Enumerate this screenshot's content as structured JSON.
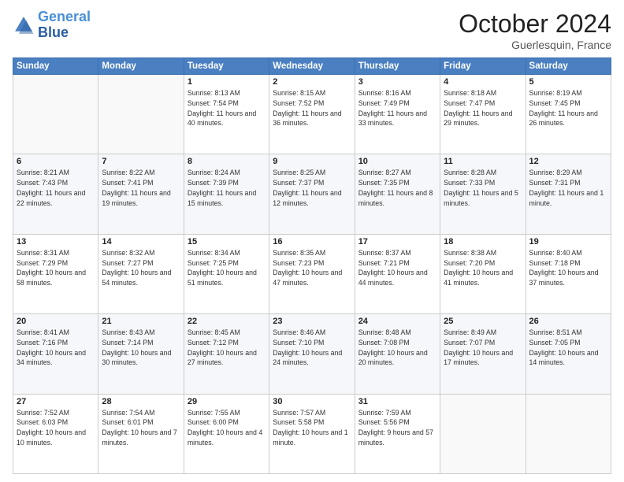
{
  "header": {
    "logo_line1": "General",
    "logo_line2": "Blue",
    "month": "October 2024",
    "location": "Guerlesquin, France"
  },
  "weekdays": [
    "Sunday",
    "Monday",
    "Tuesday",
    "Wednesday",
    "Thursday",
    "Friday",
    "Saturday"
  ],
  "weeks": [
    [
      {
        "day": "",
        "info": ""
      },
      {
        "day": "",
        "info": ""
      },
      {
        "day": "1",
        "info": "Sunrise: 8:13 AM\nSunset: 7:54 PM\nDaylight: 11 hours and 40 minutes."
      },
      {
        "day": "2",
        "info": "Sunrise: 8:15 AM\nSunset: 7:52 PM\nDaylight: 11 hours and 36 minutes."
      },
      {
        "day": "3",
        "info": "Sunrise: 8:16 AM\nSunset: 7:49 PM\nDaylight: 11 hours and 33 minutes."
      },
      {
        "day": "4",
        "info": "Sunrise: 8:18 AM\nSunset: 7:47 PM\nDaylight: 11 hours and 29 minutes."
      },
      {
        "day": "5",
        "info": "Sunrise: 8:19 AM\nSunset: 7:45 PM\nDaylight: 11 hours and 26 minutes."
      }
    ],
    [
      {
        "day": "6",
        "info": "Sunrise: 8:21 AM\nSunset: 7:43 PM\nDaylight: 11 hours and 22 minutes."
      },
      {
        "day": "7",
        "info": "Sunrise: 8:22 AM\nSunset: 7:41 PM\nDaylight: 11 hours and 19 minutes."
      },
      {
        "day": "8",
        "info": "Sunrise: 8:24 AM\nSunset: 7:39 PM\nDaylight: 11 hours and 15 minutes."
      },
      {
        "day": "9",
        "info": "Sunrise: 8:25 AM\nSunset: 7:37 PM\nDaylight: 11 hours and 12 minutes."
      },
      {
        "day": "10",
        "info": "Sunrise: 8:27 AM\nSunset: 7:35 PM\nDaylight: 11 hours and 8 minutes."
      },
      {
        "day": "11",
        "info": "Sunrise: 8:28 AM\nSunset: 7:33 PM\nDaylight: 11 hours and 5 minutes."
      },
      {
        "day": "12",
        "info": "Sunrise: 8:29 AM\nSunset: 7:31 PM\nDaylight: 11 hours and 1 minute."
      }
    ],
    [
      {
        "day": "13",
        "info": "Sunrise: 8:31 AM\nSunset: 7:29 PM\nDaylight: 10 hours and 58 minutes."
      },
      {
        "day": "14",
        "info": "Sunrise: 8:32 AM\nSunset: 7:27 PM\nDaylight: 10 hours and 54 minutes."
      },
      {
        "day": "15",
        "info": "Sunrise: 8:34 AM\nSunset: 7:25 PM\nDaylight: 10 hours and 51 minutes."
      },
      {
        "day": "16",
        "info": "Sunrise: 8:35 AM\nSunset: 7:23 PM\nDaylight: 10 hours and 47 minutes."
      },
      {
        "day": "17",
        "info": "Sunrise: 8:37 AM\nSunset: 7:21 PM\nDaylight: 10 hours and 44 minutes."
      },
      {
        "day": "18",
        "info": "Sunrise: 8:38 AM\nSunset: 7:20 PM\nDaylight: 10 hours and 41 minutes."
      },
      {
        "day": "19",
        "info": "Sunrise: 8:40 AM\nSunset: 7:18 PM\nDaylight: 10 hours and 37 minutes."
      }
    ],
    [
      {
        "day": "20",
        "info": "Sunrise: 8:41 AM\nSunset: 7:16 PM\nDaylight: 10 hours and 34 minutes."
      },
      {
        "day": "21",
        "info": "Sunrise: 8:43 AM\nSunset: 7:14 PM\nDaylight: 10 hours and 30 minutes."
      },
      {
        "day": "22",
        "info": "Sunrise: 8:45 AM\nSunset: 7:12 PM\nDaylight: 10 hours and 27 minutes."
      },
      {
        "day": "23",
        "info": "Sunrise: 8:46 AM\nSunset: 7:10 PM\nDaylight: 10 hours and 24 minutes."
      },
      {
        "day": "24",
        "info": "Sunrise: 8:48 AM\nSunset: 7:08 PM\nDaylight: 10 hours and 20 minutes."
      },
      {
        "day": "25",
        "info": "Sunrise: 8:49 AM\nSunset: 7:07 PM\nDaylight: 10 hours and 17 minutes."
      },
      {
        "day": "26",
        "info": "Sunrise: 8:51 AM\nSunset: 7:05 PM\nDaylight: 10 hours and 14 minutes."
      }
    ],
    [
      {
        "day": "27",
        "info": "Sunrise: 7:52 AM\nSunset: 6:03 PM\nDaylight: 10 hours and 10 minutes."
      },
      {
        "day": "28",
        "info": "Sunrise: 7:54 AM\nSunset: 6:01 PM\nDaylight: 10 hours and 7 minutes."
      },
      {
        "day": "29",
        "info": "Sunrise: 7:55 AM\nSunset: 6:00 PM\nDaylight: 10 hours and 4 minutes."
      },
      {
        "day": "30",
        "info": "Sunrise: 7:57 AM\nSunset: 5:58 PM\nDaylight: 10 hours and 1 minute."
      },
      {
        "day": "31",
        "info": "Sunrise: 7:59 AM\nSunset: 5:56 PM\nDaylight: 9 hours and 57 minutes."
      },
      {
        "day": "",
        "info": ""
      },
      {
        "day": "",
        "info": ""
      }
    ]
  ]
}
